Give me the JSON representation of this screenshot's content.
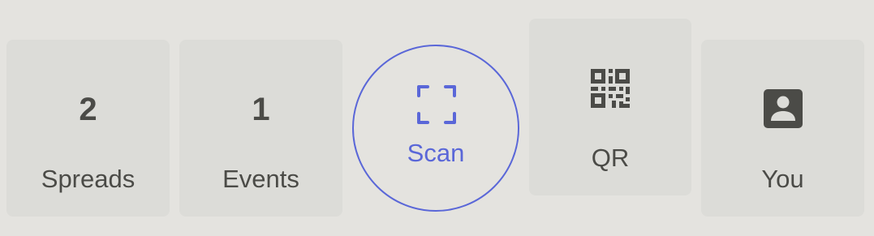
{
  "bottom_nav": {
    "spreads": {
      "count": "2",
      "label": "Spreads"
    },
    "events": {
      "count": "1",
      "label": "Events"
    },
    "scan": {
      "label": "Scan",
      "icon": "scan-frame-icon"
    },
    "qr": {
      "label": "QR",
      "icon": "qr-code-icon"
    },
    "you": {
      "label": "You",
      "icon": "account-box-icon"
    }
  },
  "colors": {
    "background": "#e4e3df",
    "tile": "#dcdcd8",
    "text": "#4b4b47",
    "accent": "#5a67d8"
  }
}
